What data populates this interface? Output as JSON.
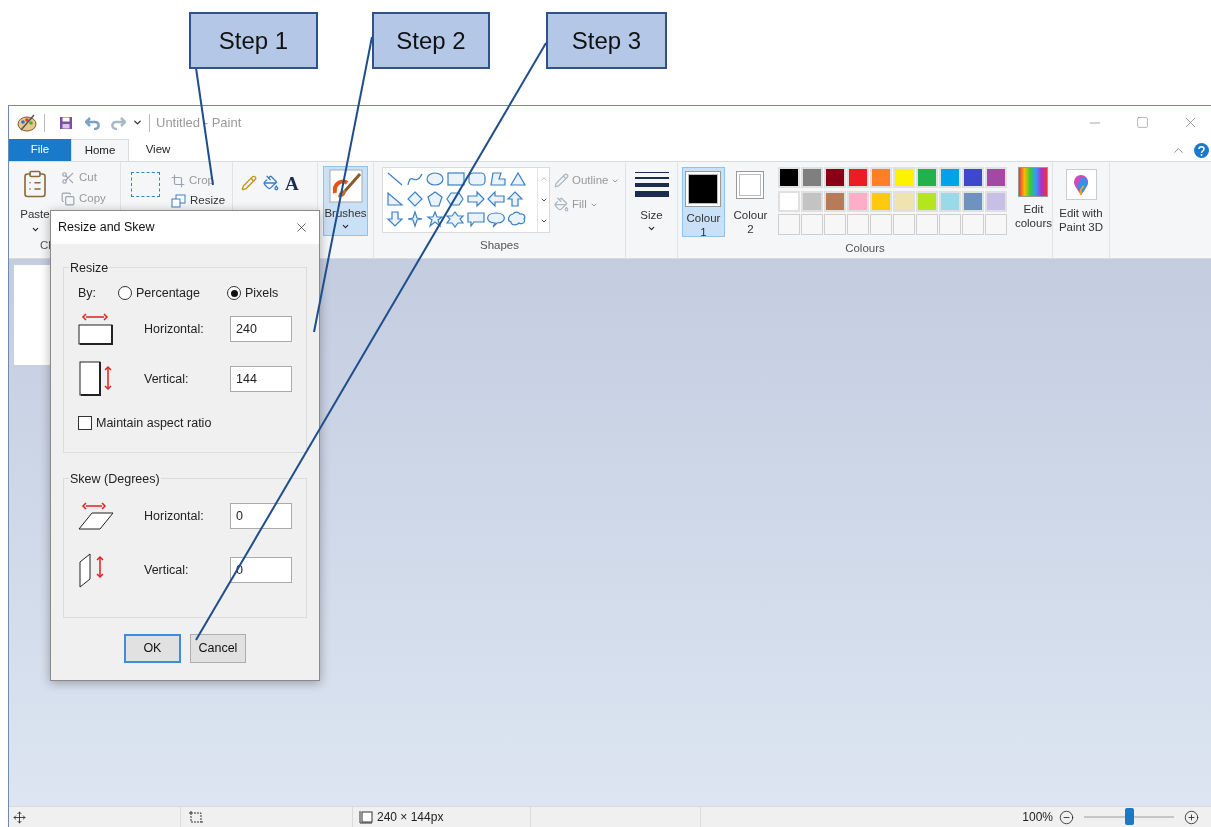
{
  "callouts": [
    {
      "label": "Step 1"
    },
    {
      "label": "Step 2"
    },
    {
      "label": "Step 3"
    }
  ],
  "window": {
    "title": "Untitled - Paint"
  },
  "tabs": [
    {
      "label": "File",
      "kind": "file",
      "selected": false
    },
    {
      "label": "Home",
      "kind": "tab",
      "selected": true
    },
    {
      "label": "View",
      "kind": "tab",
      "selected": false
    }
  ],
  "ribbon": {
    "clipboard": {
      "paste": "Paste",
      "cut": "Cut",
      "copy": "Copy",
      "group_label": "Cl"
    },
    "image": {
      "crop": "Crop",
      "resize": "Resize"
    },
    "tools": {
      "text_tool": "A"
    },
    "brushes": {
      "label": "Brushes",
      "selected": true
    },
    "shapes": {
      "outline": "Outline",
      "fill": "Fill",
      "group_label": "Shapes"
    },
    "size": {
      "label": "Size"
    },
    "colours": {
      "slots": [
        {
          "label": "Colour",
          "number": "1",
          "color": "#000000",
          "selected": true
        },
        {
          "label": "Colour",
          "number": "2",
          "color": "#ffffff",
          "selected": false
        }
      ],
      "palette": [
        {
          "color": "#000000"
        },
        {
          "color": "#7f7f7f"
        },
        {
          "color": "#880015"
        },
        {
          "color": "#ed1c24"
        },
        {
          "color": "#ff7f27"
        },
        {
          "color": "#fff200"
        },
        {
          "color": "#22b14c"
        },
        {
          "color": "#00a2e8"
        },
        {
          "color": "#3f48cc"
        },
        {
          "color": "#a349a4"
        },
        {
          "color": "#ffffff"
        },
        {
          "color": "#c3c3c3"
        },
        {
          "color": "#b97a57"
        },
        {
          "color": "#ffaec9"
        },
        {
          "color": "#ffc90e"
        },
        {
          "color": "#efe4b0"
        },
        {
          "color": "#b5e61d"
        },
        {
          "color": "#99d9ea"
        },
        {
          "color": "#7092be"
        },
        {
          "color": "#c8bfe7"
        }
      ],
      "edit_colours": [
        "Edit",
        "colours"
      ],
      "group_label": "Colours"
    },
    "paint3d": {
      "lines": [
        "Edit with",
        "Paint 3D"
      ]
    }
  },
  "dialog": {
    "title": "Resize and Skew",
    "resize": {
      "heading": "Resize",
      "by_label": "By:",
      "options": [
        {
          "label": "Percentage",
          "selected": false
        },
        {
          "label": "Pixels",
          "selected": true
        }
      ],
      "fields": [
        {
          "label": "Horizontal:",
          "value": "240"
        },
        {
          "label": "Vertical:",
          "value": "144"
        }
      ],
      "maintain_aspect": {
        "label": "Maintain aspect ratio",
        "checked": false
      }
    },
    "skew": {
      "heading": "Skew (Degrees)",
      "fields": [
        {
          "label": "Horizontal:",
          "value": "0"
        },
        {
          "label": "Vertical:",
          "value": "0"
        }
      ]
    },
    "buttons": [
      {
        "label": "OK",
        "default": true
      },
      {
        "label": "Cancel",
        "default": false
      }
    ]
  },
  "status_bar": {
    "size": "240 × 144px",
    "zoom": "100%",
    "zoom_slider": {
      "level": 0.5
    }
  }
}
